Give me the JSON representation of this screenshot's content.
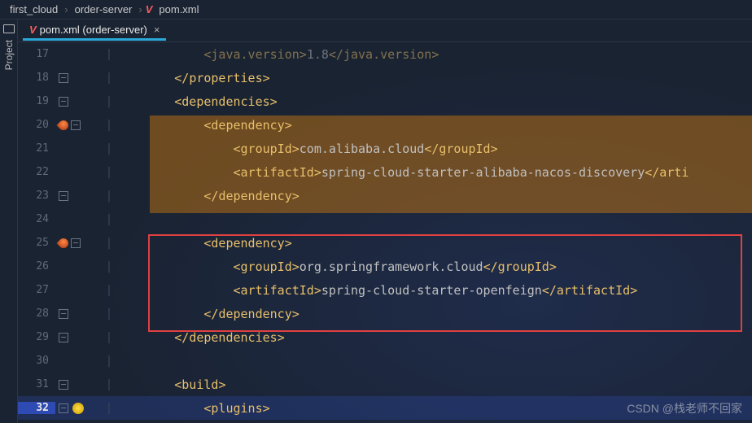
{
  "breadcrumb": {
    "c1": "first_cloud",
    "c2": "order-server",
    "c3": "pom.xml"
  },
  "sidebar": {
    "label": "Project"
  },
  "tab": {
    "label": "pom.xml (order-server)",
    "close": "×"
  },
  "lines": {
    "n17": "17",
    "n18": "18",
    "n19": "19",
    "n20": "20",
    "n21": "21",
    "n22": "22",
    "n23": "23",
    "n24": "24",
    "n25": "25",
    "n26": "26",
    "n27": "27",
    "n28": "28",
    "n29": "29",
    "n30": "30",
    "n31": "31",
    "n32": "32"
  },
  "code": {
    "l17a": "            <",
    "l17b": "java.version",
    "l17c": ">",
    "l17d": "1.8",
    "l17e": "</",
    "l17f": "java.version",
    "l17g": ">",
    "l18a": "        </",
    "l18b": "properties",
    "l18c": ">",
    "l19a": "        <",
    "l19b": "dependencies",
    "l19c": ">",
    "l20a": "            <",
    "l20b": "dependency",
    "l20c": ">",
    "l21a": "                <",
    "l21b": "groupId",
    "l21c": ">",
    "l21d": "com.alibaba.cloud",
    "l21e": "</",
    "l21f": "groupId",
    "l21g": ">",
    "l22a": "                <",
    "l22b": "artifactId",
    "l22c": ">",
    "l22d": "spring-cloud-starter-alibaba-nacos-discovery",
    "l22e": "</",
    "l22f": "arti",
    "l23a": "            </",
    "l23b": "dependency",
    "l23c": ">",
    "l25a": "            <",
    "l25b": "dependency",
    "l25c": ">",
    "l26a": "                <",
    "l26b": "groupId",
    "l26c": ">",
    "l26d": "org.springframework.cloud",
    "l26e": "</",
    "l26f": "groupId",
    "l26g": ">",
    "l27a": "                <",
    "l27b": "artifactId",
    "l27c": ">",
    "l27d": "spring-cloud-starter-openfeign",
    "l27e": "</",
    "l27f": "artifactId",
    "l27g": ">",
    "l28a": "            </",
    "l28b": "dependency",
    "l28c": ">",
    "l29a": "        </",
    "l29b": "dependencies",
    "l29c": ">",
    "l31a": "        <",
    "l31b": "build",
    "l31c": ">",
    "l32a": "            <",
    "l32b": "plugins",
    "l32c": ">"
  },
  "watermark": "CSDN @栈老师不回家"
}
